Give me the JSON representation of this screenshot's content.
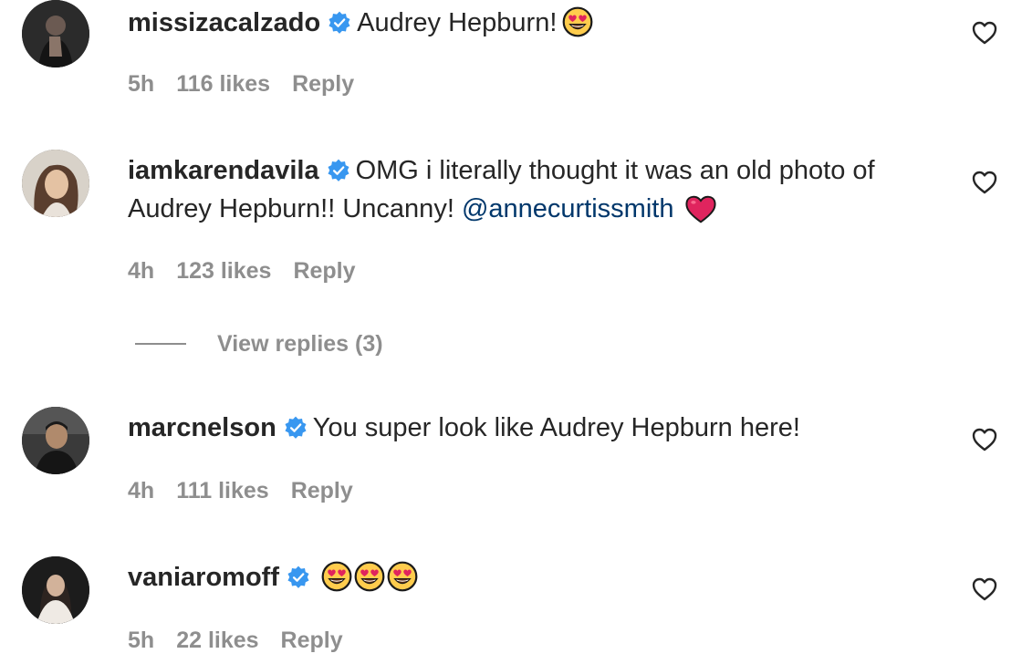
{
  "colors": {
    "text": "#262626",
    "meta": "#8e8e8e",
    "mention": "#00376b",
    "verified": "#3897f0",
    "heart": "#e0245e"
  },
  "comments": [
    {
      "username": "missizacalzado",
      "text": "Audrey Hepburn!",
      "emojis": [
        "heart-eyes-emoji"
      ],
      "time": "5h",
      "likes": "116 likes",
      "reply": "Reply"
    },
    {
      "username": "iamkarendavila",
      "text": "OMG i literally thought it was an old photo of Audrey Hepburn!! Uncanny!",
      "mention": "@annecurtissmith",
      "emojis": [
        "red-heart-emoji"
      ],
      "time": "4h",
      "likes": "123 likes",
      "reply": "Reply",
      "view_replies": "View replies (3)"
    },
    {
      "username": "marcnelson",
      "text": "You super look like Audrey Hepburn here!",
      "time": "4h",
      "likes": "111 likes",
      "reply": "Reply"
    },
    {
      "username": "vaniaromoff",
      "text": "",
      "emojis": [
        "heart-eyes-emoji",
        "heart-eyes-emoji",
        "heart-eyes-emoji"
      ],
      "time": "5h",
      "likes": "22 likes",
      "reply": "Reply"
    }
  ],
  "icons": {
    "verified": "verified-badge-icon",
    "like": "heart-outline-icon"
  }
}
